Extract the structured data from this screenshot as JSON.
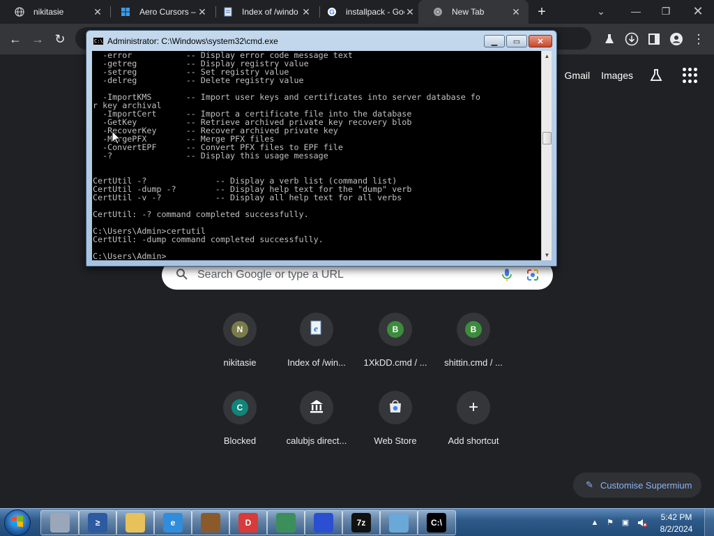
{
  "browser": {
    "tabs": [
      {
        "title": "nikitasie",
        "icon": "globe-icon",
        "active": false
      },
      {
        "title": "Aero Cursors – W",
        "icon": "windows-icon",
        "active": false
      },
      {
        "title": "Index of /windo",
        "icon": "document-icon",
        "active": false
      },
      {
        "title": "installpack - Goo",
        "icon": "google-icon",
        "active": false
      },
      {
        "title": "New Tab",
        "icon": "chrome-icon",
        "active": true
      }
    ],
    "new_tab_symbol": "+"
  },
  "ntp": {
    "top_links": [
      "Gmail",
      "Images"
    ],
    "search_placeholder": "Search Google or type a URL",
    "shortcuts_row1": [
      {
        "label": "nikitasie",
        "badge": "N",
        "color": "#7b7b4a"
      },
      {
        "label": "Index of /win...",
        "badge": "",
        "color": "#1a73e8"
      },
      {
        "label": "1XkDD.cmd / ...",
        "badge": "B",
        "color": "#3c8c3c"
      },
      {
        "label": "shittin.cmd / ...",
        "badge": "B",
        "color": "#3c8c3c"
      }
    ],
    "shortcuts_row2": [
      {
        "label": "Blocked",
        "badge": "C",
        "color": "#11857a"
      },
      {
        "label": "calubjs direct...",
        "badge": "",
        "color": "#ffffff"
      },
      {
        "label": "Web Store",
        "badge": "",
        "color": "#4285f4"
      },
      {
        "label": "Add shortcut",
        "badge": "+",
        "color": "#ffffff"
      }
    ],
    "customise_label": "Customise Supermium"
  },
  "cmd": {
    "title": "Administrator: C:\\Windows\\system32\\cmd.exe",
    "icon_text": "C:\\",
    "lines": [
      "  -error           -- Display error code message text",
      "  -getreg          -- Display registry value",
      "  -setreg          -- Set registry value",
      "  -delreg          -- Delete registry value",
      "",
      "  -ImportKMS       -- Import user keys and certificates into server database fo",
      "r key archival",
      "  -ImportCert      -- Import a certificate file into the database",
      "  -GetKey          -- Retrieve archived private key recovery blob",
      "  -RecoverKey      -- Recover archived private key",
      "  -MergePFX        -- Merge PFX files",
      "  -ConvertEPF      -- Convert PFX files to EPF file",
      "  -?               -- Display this usage message",
      "",
      "",
      "CertUtil -?              -- Display a verb list (command list)",
      "CertUtil -dump -?        -- Display help text for the \"dump\" verb",
      "CertUtil -v -?           -- Display all help text for all verbs",
      "",
      "CertUtil: -? command completed successfully.",
      "",
      "C:\\Users\\Admin>certutil",
      "CertUtil: -dump command completed successfully.",
      "",
      "C:\\Users\\Admin>"
    ]
  },
  "taskbar": {
    "apps": [
      {
        "name": "server-manager-icon",
        "color": "#9aa7b8",
        "text": ""
      },
      {
        "name": "powershell-icon",
        "color": "#2d5aa0",
        "text": "≥"
      },
      {
        "name": "explorer-icon",
        "color": "#e8c15a",
        "text": ""
      },
      {
        "name": "internet-explorer-icon",
        "color": "#2f8ddb",
        "text": "e"
      },
      {
        "name": "winrar-icon",
        "color": "#8b5a2b",
        "text": ""
      },
      {
        "name": "dtools-icon",
        "color": "#d93a3a",
        "text": "D"
      },
      {
        "name": "browser-icon",
        "color": "#3a8f5a",
        "text": ""
      },
      {
        "name": "shark-icon",
        "color": "#2a4fd0",
        "text": ""
      },
      {
        "name": "7zip-icon",
        "color": "#111111",
        "text": "7z"
      },
      {
        "name": "control-panel-icon",
        "color": "#6aa8d8",
        "text": ""
      },
      {
        "name": "cmd-icon",
        "color": "#000000",
        "text": "C:\\"
      }
    ],
    "clock_time": "5:42 PM",
    "clock_date": "8/2/2024"
  }
}
